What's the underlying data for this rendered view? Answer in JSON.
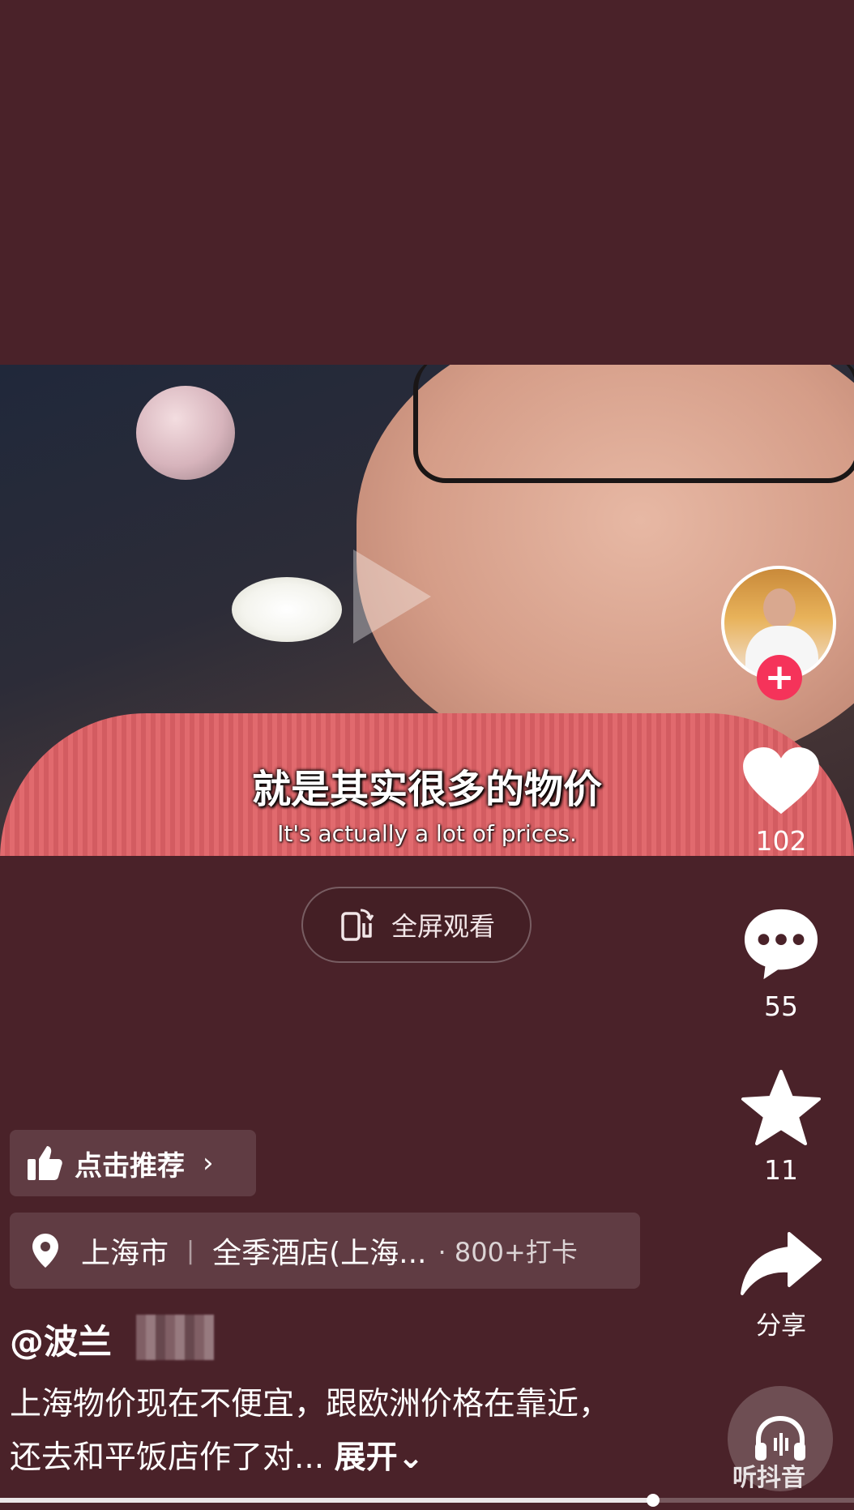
{
  "video": {
    "subtitle_cn": "就是其实很多的物价",
    "subtitle_en": "It's actually a lot of prices."
  },
  "fullscreen": {
    "label": "全屏观看"
  },
  "sidebar": {
    "likes": "102",
    "comments": "55",
    "favorites": "11",
    "share_label": "分享",
    "music_label": "听抖音"
  },
  "recommend": {
    "label": "点击推荐"
  },
  "location": {
    "city": "上海市",
    "place": "全季酒店(上海...",
    "checkin": "· 800+打卡"
  },
  "author": {
    "name": "@波兰"
  },
  "description": {
    "text": "上海物价现在不便宜，跟欧洲价格在靠近，还去和平饭店作了对...",
    "more_label": "展开"
  },
  "progress": {
    "fraction": 0.765
  },
  "colors": {
    "background": "#4a2229",
    "follow": "#f5335a"
  }
}
